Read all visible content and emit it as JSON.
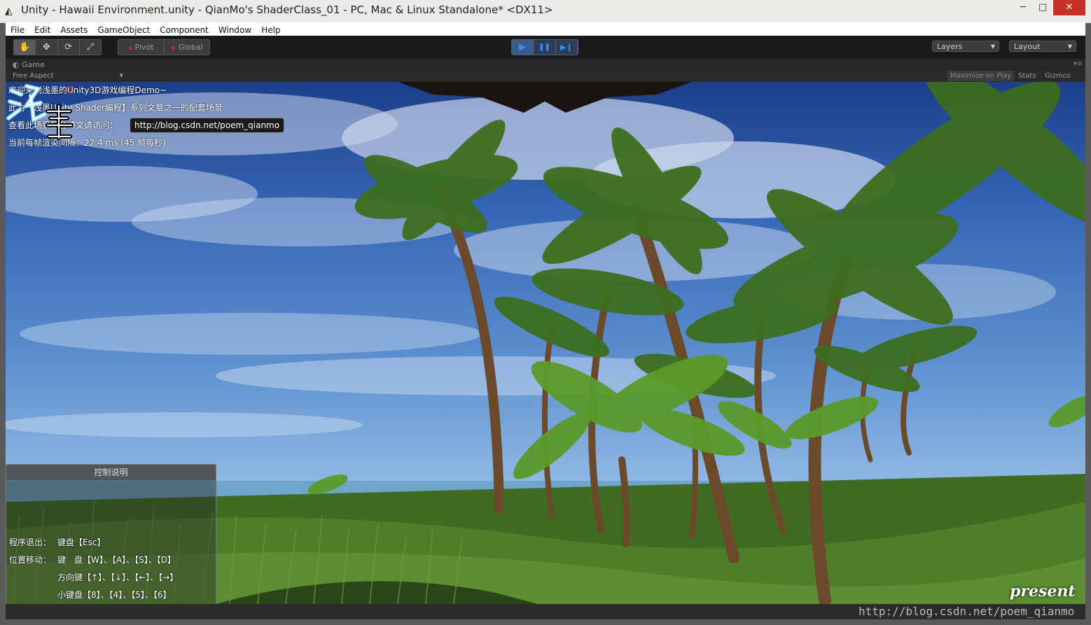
{
  "window": {
    "title": "Unity - Hawaii Environment.unity - QianMo's ShaderClass_01 - PC, Mac & Linux Standalone* <DX11>",
    "app_icon": "unity-icon",
    "minimize": "─",
    "maximize": "□",
    "close": "✕"
  },
  "menubar": [
    "File",
    "Edit",
    "Assets",
    "GameObject",
    "Component",
    "Window",
    "Help"
  ],
  "toolbar": {
    "tools": [
      "✋",
      "✥",
      "⟳",
      "⤢"
    ],
    "pivot_label": "Pivot",
    "global_label": "Global",
    "play": "▶",
    "pause": "❚❚",
    "step": "▶❙",
    "layers_label": "Layers",
    "layout_label": "Layout",
    "dropdown_arrow": "▼"
  },
  "game_view": {
    "tab_label": "Game",
    "tab_menu": "▾≡",
    "aspect_label": "Free Aspect",
    "maximize_on_play": "Maximize on Play",
    "stats": "Stats",
    "gizmos": "Gizmos"
  },
  "hud": {
    "welcome": "欢迎来到浅墨的Unity3D游戏编程Demo~",
    "series": "此为【浅墨Unity Shader编程】系列文章之一的配套场景",
    "visit_prefix": "查看此场景配套博文请访问：",
    "url": "http://blog.csdn.net/poem_qianmo",
    "frame_time": "当前每帧渲染间隔：22.4 ms (45 帧每秒)"
  },
  "control_panel": {
    "title": "控制说明",
    "exit_label": "程序退出：",
    "exit_value": "键盘【Esc】",
    "move_label": "位置移动：",
    "move_keyboard": "键　盘【W】、【A】、【S】、【D】",
    "move_arrows": "方向键【↑】、【↓】、【←】、【→】",
    "move_numpad": "小键盘【8】、【4】、【5】、【6】"
  },
  "logo": {
    "present": "present",
    "copyright": "©"
  },
  "watermark": "http://blog.csdn.net/poem_qianmo"
}
